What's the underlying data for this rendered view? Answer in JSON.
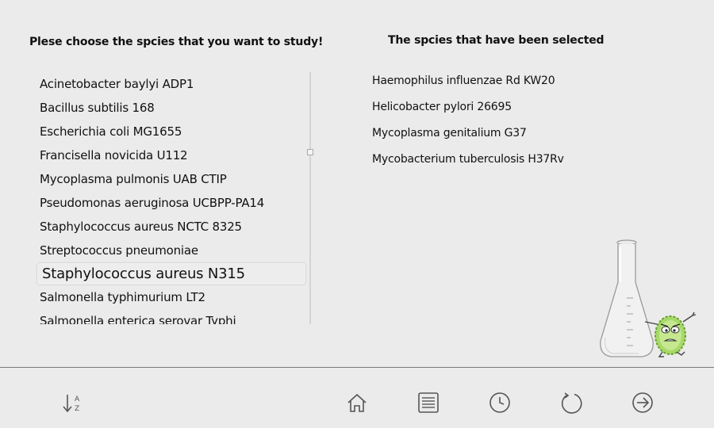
{
  "left_panel": {
    "heading": "Plese choose the spcies that you want to study!",
    "species": [
      "Acinetobacter baylyi ADP1",
      "Bacillus subtilis 168",
      "Escherichia coli MG1655",
      "Francisella novicida U112",
      "Mycoplasma pulmonis UAB CTIP",
      "Pseudomonas aeruginosa UCBPP-PA14",
      "Staphylococcus aureus NCTC 8325",
      "Streptococcus pneumoniae",
      "Staphylococcus aureus N315",
      "Salmonella typhimurium LT2",
      "Salmonella enterica serovar Typhi"
    ],
    "highlighted_index": 8
  },
  "right_panel": {
    "heading": "The spcies that have been selected",
    "selected": [
      "Haemophilus influenzae Rd KW20",
      "Helicobacter pylori 26695",
      "Mycoplasma genitalium G37",
      "Mycobacterium tuberculosis H37Rv"
    ]
  },
  "toolbar": {
    "sort": {
      "icon": "sort-az-icon",
      "glyph_top": "A",
      "glyph_bottom": "Z"
    },
    "home": {
      "icon": "home-icon"
    },
    "list": {
      "icon": "list-icon"
    },
    "history": {
      "icon": "clock-icon"
    },
    "refresh": {
      "icon": "refresh-icon"
    },
    "next": {
      "icon": "arrow-right-circle-icon"
    }
  },
  "colors": {
    "background": "#ebebeb",
    "icon": "#555555",
    "mascot": "#8bc34a"
  }
}
